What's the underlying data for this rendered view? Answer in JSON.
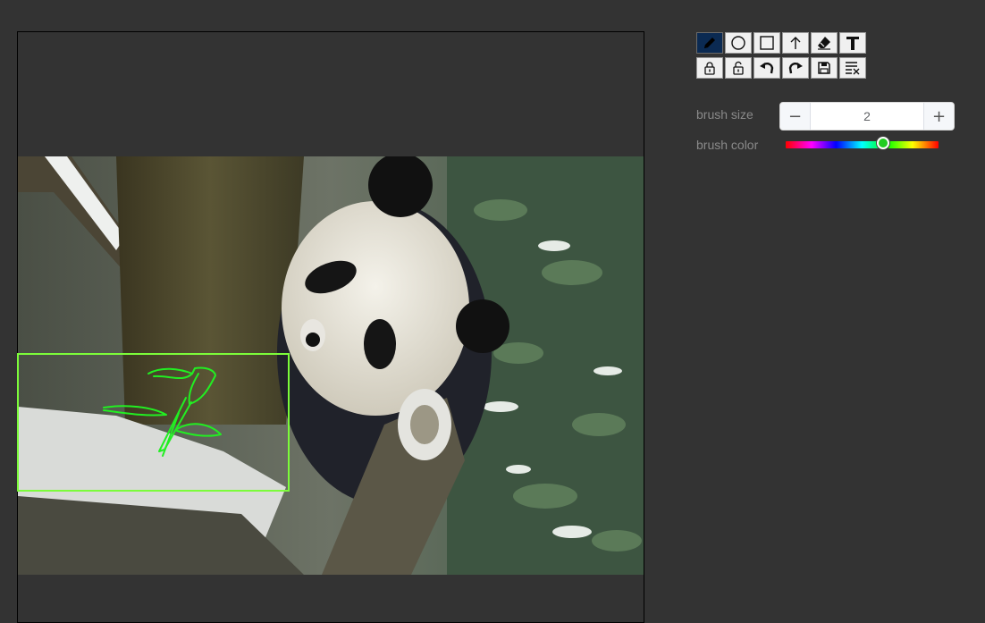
{
  "toolbar": {
    "row1": [
      {
        "name": "pencil-tool-button",
        "icon": "pencil-icon",
        "active": true
      },
      {
        "name": "circle-tool-button",
        "icon": "circle-icon",
        "active": false
      },
      {
        "name": "rectangle-tool-button",
        "icon": "square-icon",
        "active": false
      },
      {
        "name": "arrow-tool-button",
        "icon": "arrow-up-icon",
        "active": false
      },
      {
        "name": "eraser-tool-button",
        "icon": "eraser-icon",
        "active": false
      },
      {
        "name": "text-tool-button",
        "icon": "text-icon",
        "active": false
      }
    ],
    "row2": [
      {
        "name": "lock-button",
        "icon": "lock-icon"
      },
      {
        "name": "unlock-button",
        "icon": "unlock-icon"
      },
      {
        "name": "undo-button",
        "icon": "undo-icon"
      },
      {
        "name": "redo-button",
        "icon": "redo-icon"
      },
      {
        "name": "save-button",
        "icon": "save-icon"
      },
      {
        "name": "clear-button",
        "icon": "clear-icon"
      }
    ]
  },
  "properties": {
    "brush_size_label": "brush size",
    "brush_size_value": "2",
    "brush_color_label": "brush color",
    "brush_color_value": "#22cc22",
    "hue_position": 0.64
  },
  "colors": {
    "background": "#333333",
    "selection": "#7cfc3a",
    "stroke": "#22ee22",
    "active_tool": "#0b2a52"
  }
}
